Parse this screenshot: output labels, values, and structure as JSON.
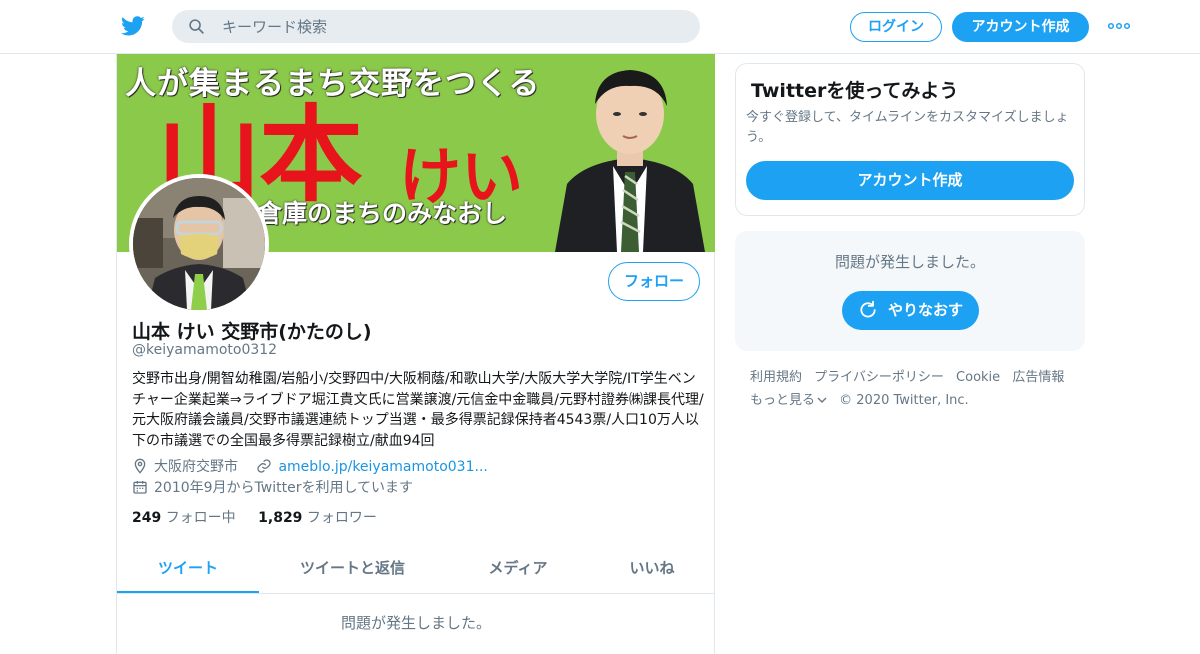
{
  "header": {
    "search_placeholder": "キーワード検索",
    "login_label": "ログイン",
    "signup_label": "アカウント作成",
    "more_icon": "more-dots-icon"
  },
  "colors": {
    "accent": "#1da1f2",
    "link": "#1b95e0",
    "secondary_text": "#657786",
    "banner_green": "#8bc94a",
    "banner_red": "#e8141b"
  },
  "banner": {
    "line1": "人が集まるまち交野をつくる",
    "name": "山本",
    "kana": "けい",
    "line3": "倉庫のまちのみなおし"
  },
  "profile": {
    "follow_label": "フォロー",
    "display_name": "山本 けい 交野市(かたのし)",
    "handle": "@keiyamamoto0312",
    "bio": "交野市出身/開智幼稚園/岩船小/交野四中/大阪桐蔭/和歌山大学/大阪大学大学院/IT学生ベンチャー企業起業⇒ライブドア堀江貴文氏に営業譲渡/元信金中金職員/元野村證券㈱課長代理/元大阪府議会議員/交野市議選連続トップ当選・最多得票記録保持者4543票/人口10万人以下の市議選での全国最多得票記録樹立/献血94回",
    "location": "大阪府交野市",
    "url": "ameblo.jp/keiyamamoto031...",
    "joined": "2010年9月からTwitterを利用しています",
    "following_count": "249",
    "following_label": "フォロー中",
    "followers_count": "1,829",
    "followers_label": "フォロワー"
  },
  "tabs": [
    {
      "label": "ツイート",
      "active": true
    },
    {
      "label": "ツイートと返信",
      "active": false
    },
    {
      "label": "メディア",
      "active": false
    },
    {
      "label": "いいね",
      "active": false
    }
  ],
  "timeline": {
    "error": "問題が発生しました。"
  },
  "sidebar": {
    "signup_title": "Twitterを使ってみよう",
    "signup_desc": "今すぐ登録して、タイムラインをカスタマイズしましょう。",
    "signup_button": "アカウント作成",
    "error_text": "問題が発生しました。",
    "retry_label": "やりなおす"
  },
  "footer": {
    "links": [
      "利用規約",
      "プライバシーポリシー",
      "Cookie",
      "広告情報"
    ],
    "more": "もっと見る",
    "copyright": "© 2020 Twitter, Inc."
  }
}
